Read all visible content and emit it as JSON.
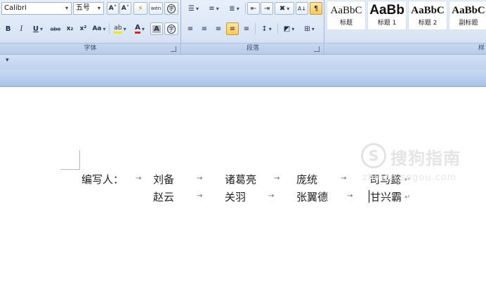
{
  "font_group": {
    "font_name": "Calibri",
    "font_size": "五号",
    "grow_font_glyph": "A˄",
    "shrink_font_glyph": "A˅",
    "clear_format_glyph": "⚡",
    "phonetic_glyph": "wén",
    "border_char_glyph": "A",
    "enclosed_char_glyph": "字",
    "bold": "B",
    "italic": "I",
    "underline": "U",
    "strike": "abe",
    "subscript": "x₂",
    "superscript": "x²",
    "change_case": "Aa",
    "highlight": "ab",
    "font_color": "A",
    "char_shading": "A",
    "label": "字体"
  },
  "para_group": {
    "bullets_glyph": "☰",
    "numbering_glyph": "≡",
    "multilevel_glyph": "≣",
    "decrease_indent_glyph": "⇤",
    "increase_indent_glyph": "⇥",
    "chinese_layout_glyph": "✖",
    "sort_glyph": "A↓",
    "show_marks_glyph": "¶",
    "align_left_glyph": "≡",
    "center_glyph": "≡",
    "align_right_glyph": "≡",
    "justify_glyph": "≡",
    "distributed_glyph": "≡",
    "line_spacing_glyph": "↕",
    "shading_glyph": "◩",
    "borders_glyph": "⊞",
    "label": "段落"
  },
  "styles_group": {
    "items": [
      {
        "sample": "AaBbC",
        "name": "标题"
      },
      {
        "sample": "AaBb",
        "name": "标题 1"
      },
      {
        "sample": "AaBbC",
        "name": "标题 2"
      },
      {
        "sample": "AaBbC",
        "name": "副标题"
      }
    ],
    "label": "样"
  },
  "qat": {
    "dropdown_glyph": "▾"
  },
  "document": {
    "row1": [
      "编写人：",
      "刘备",
      "诸葛亮",
      "庞统",
      "司马懿"
    ],
    "row2": [
      "赵云",
      "关羽",
      "张翼德",
      "甘兴霸"
    ],
    "tab_glyph": "→",
    "para_glyph": "↵"
  },
  "watermark": {
    "logo_glyph": "S",
    "brand": "搜狗指南",
    "url": "zhinan.sogou.com"
  },
  "colors": {
    "highlight": "#ffe600",
    "font_color": "#e02020",
    "ribbon_border": "#9fb4d3"
  }
}
